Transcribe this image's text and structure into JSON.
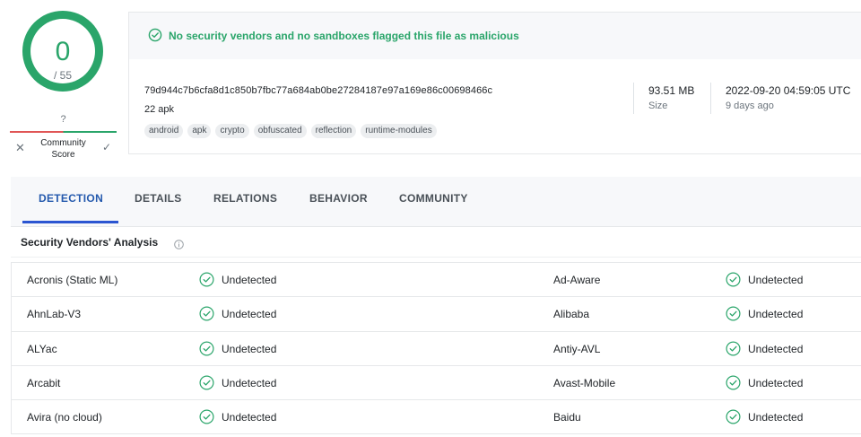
{
  "score": {
    "value": "0",
    "total": "/ 55"
  },
  "community": {
    "score": "?",
    "label": "Community Score",
    "reject_glyph": "✕",
    "accept_glyph": "✓"
  },
  "banner": {
    "message": "No security vendors and no sandboxes flagged this file as malicious",
    "icon": "check-circle-icon"
  },
  "file": {
    "hash": "79d944c7b6cfa8d1c850b7fbc77a684ab0be27284187e97a169e86c00698466c",
    "name": "22 apk",
    "tags": [
      "android",
      "apk",
      "crypto",
      "obfuscated",
      "reflection",
      "runtime-modules"
    ],
    "size": "93.51 MB",
    "size_label": "Size",
    "date": "2022-09-20 04:59:05 UTC",
    "date_ago": "9 days ago"
  },
  "tabs": [
    {
      "label": "DETECTION",
      "active": true
    },
    {
      "label": "DETAILS",
      "active": false
    },
    {
      "label": "RELATIONS",
      "active": false
    },
    {
      "label": "BEHAVIOR",
      "active": false
    },
    {
      "label": "COMMUNITY",
      "active": false
    }
  ],
  "section": {
    "title": "Security Vendors' Analysis",
    "info_icon": "info-icon"
  },
  "vendors": [
    {
      "left": {
        "name": "Acronis (Static ML)",
        "result": "Undetected"
      },
      "right": {
        "name": "Ad-Aware",
        "result": "Undetected"
      }
    },
    {
      "left": {
        "name": "AhnLab-V3",
        "result": "Undetected"
      },
      "right": {
        "name": "Alibaba",
        "result": "Undetected"
      }
    },
    {
      "left": {
        "name": "ALYac",
        "result": "Undetected"
      },
      "right": {
        "name": "Antiy-AVL",
        "result": "Undetected"
      }
    },
    {
      "left": {
        "name": "Arcabit",
        "result": "Undetected"
      },
      "right": {
        "name": "Avast-Mobile",
        "result": "Undetected"
      }
    },
    {
      "left": {
        "name": "Avira (no cloud)",
        "result": "Undetected"
      },
      "right": {
        "name": "Baidu",
        "result": "Undetected"
      }
    }
  ],
  "colors": {
    "clean": "#2aa56a",
    "malicious": "#e05656",
    "accent": "#2b55d1"
  }
}
